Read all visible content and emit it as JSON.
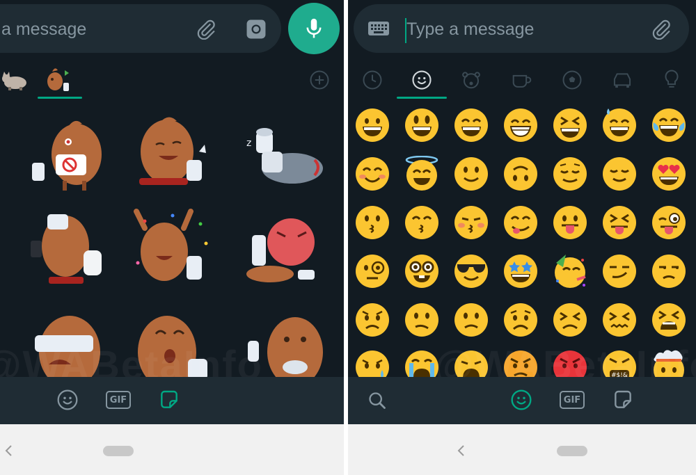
{
  "left": {
    "input_text": "a message",
    "watermark": "@WABetaInfo",
    "icons": {
      "attach": "paperclip-icon",
      "camera": "camera-icon",
      "mic": "microphone-icon",
      "add_pack": "plus-circle-icon",
      "emoji_tab": "smiley-icon",
      "gif_tab": "gif-icon",
      "sticker_tab": "sticker-icon"
    },
    "gif_label": "GIF",
    "sticker_packs": [
      "cat-pack",
      "poop-pack"
    ]
  },
  "right": {
    "input_placeholder": "Type a message",
    "watermark": "@WABetaInfo",
    "categories": [
      "recent",
      "smileys",
      "animals",
      "food",
      "activity",
      "travel",
      "objects"
    ],
    "gif_label": "GIF",
    "icons": {
      "keyboard": "keyboard-icon",
      "attach": "paperclip-icon",
      "search": "search-icon"
    }
  },
  "colors": {
    "accent": "#00a884",
    "background": "#121b22",
    "panel": "#1f2c34",
    "mic": "#1fac8e",
    "emoji_yellow": "#fbc531"
  }
}
